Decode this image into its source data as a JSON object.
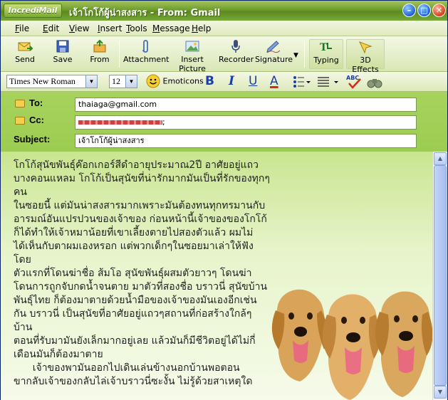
{
  "window": {
    "app_name": "IncrediMail",
    "title": "เจ้าโกโก้ผู้น่าสงสาร - From: Gmail",
    "controls": {
      "minimize": "–",
      "maximize": "□",
      "close": "✕"
    }
  },
  "menu": [
    {
      "underline": "F",
      "rest": "ile"
    },
    {
      "underline": "E",
      "rest": "dit"
    },
    {
      "underline": "V",
      "rest": "iew"
    },
    {
      "underline": "I",
      "rest": "nsert"
    },
    {
      "underline": "T",
      "rest": "ools"
    },
    {
      "underline": "M",
      "rest": "essage"
    },
    {
      "underline": "H",
      "rest": "elp"
    }
  ],
  "toolbar": {
    "send": "Send",
    "save": "Save",
    "from": "From",
    "attachment": "Attachment",
    "insert_picture": "Insert Picture",
    "recorder": "Recorder",
    "signature": "Signature",
    "typing": "Typing",
    "effects": "3D Effects"
  },
  "format": {
    "font": "Times New Roman",
    "size": "12",
    "emoticons": "Emoticons",
    "bold": "B",
    "italic": "I",
    "underline": "U",
    "font_color": "A"
  },
  "header": {
    "to_label": "To:",
    "to_value": "thaiaga@gmail.com",
    "cc_label": "Cc:",
    "cc_value": ";",
    "subject_label": "Subject:",
    "subject_value": "เจ้าโกโก้ผู้น่าสงสาร"
  },
  "body": {
    "lines": [
      "โกโก้สุนัขพันธุ์ค๊อกเกอร์สีดำอายุประมาณ2ปี อาศัยอยู่แถว",
      "บางคอนแหลม โกโก้เป็นสุนัขที่น่ารักมากมันเป็นที่รักของทุกๆ",
      "คน",
      "ในซอยนี้ แต่มันน่าสงสารมากเพราะมันต้องทนทุกทรมานกับ",
      "อารมณ์อันแปรปวนของเจ้าของ ก่อนหน้านี้เจ้าของของโกโก้",
      "ก็ได้ทำให้เจ้าหมาน้อยที่เขาเลี้ยงตายไปสองตัวแล้ว ผมไม่",
      "ได้เห็นกับตาผมเองหรอก แต่พวกเด็กๆในซอยมาเล่าให้ฟัง",
      "โดย",
      "ตัวแรกที่โดนฆ่าชื่อ ส้มโอ สุนัขพันธุ์ผสมตัวยาวๆ โดนฆ่า",
      "โดนการถูกจับกดน้ำจนตาย มาตัวที่สองชื่อ บราวนี่ สุนัขบ้าน",
      "พันธุ์ไทย ก็ต้องมาตายด้วยน้ำมือของเจ้าของมันเองอีกเช่น",
      "กัน บราวนี่ เป็นสุนัขที่อาศัยอยู่แถวๆสถานที่ก่อสร้างใกล้ๆ",
      "บ้าน",
      "ตอนที่รับมามันยังเล็กมากอยู่เลย แล้วมันก็มีชีวิตอยู่ได้ไม่กี่",
      "เดือนมันก็ต้องมาตาย",
      "      เจ้าของพามันออกไปเดินเล่นข้างนอกบ้านพอตอน",
      "ขากลับเจ้าของกลับไล่เจ้าบราวนี่ซะงั้น ไม่รู้ด้วยสาเหตุใด"
    ]
  },
  "colors": {
    "title_green": "#6f9d2b",
    "header_green": "#9ccc52",
    "body_bg": "#e7f4ca"
  }
}
